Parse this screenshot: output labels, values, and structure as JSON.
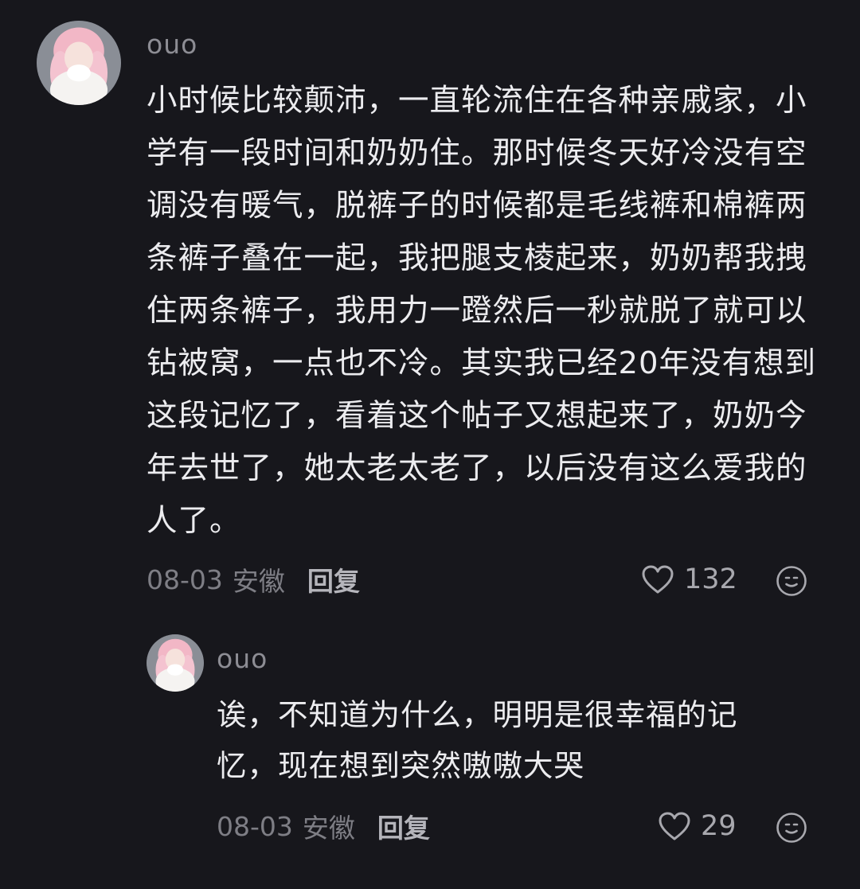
{
  "comments": [
    {
      "username": "ouo",
      "text": "小时候比较颠沛，一直轮流住在各种亲戚家，小学有一段时间和奶奶住。那时候冬天好冷没有空调没有暖气，脱裤子的时候都是毛线裤和棉裤两条裤子叠在一起，我把腿支棱起来，奶奶帮我拽住两条裤子，我用力一蹬然后一秒就脱了就可以钻被窝，一点也不冷。其实我已经20年没有想到这段记忆了，看着这个帖子又想起来了，奶奶今年去世了，她太老太老了，以后没有这么爱我的人了。",
      "date": "08-03",
      "location": "安徽",
      "reply_label": "回复",
      "likes": "132"
    },
    {
      "username": "ouo",
      "text": "诶，不知道为什么，明明是很幸福的记忆，现在想到突然嗷嗷大哭",
      "date": "08-03",
      "location": "安徽",
      "reply_label": "回复",
      "likes": "29"
    }
  ],
  "icons": {
    "like": "heart-outline-icon",
    "reaction": "smiley-face-icon"
  },
  "colors": {
    "background": "#17171c",
    "text": "#ececef",
    "muted": "#8d8d94"
  }
}
